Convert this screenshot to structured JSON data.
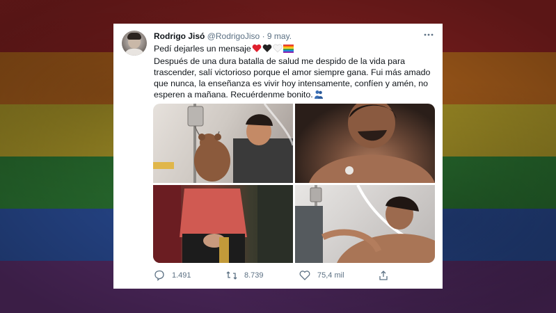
{
  "tweet": {
    "author_name": "Rodrigo Jisó",
    "handle": "@RodrigoJiso",
    "separator": "·",
    "date": "9 may.",
    "line1": "Pedí dejarles un mensaje",
    "body": "Después de una dura batalla de salud me despido de la vida para trascender, salí victorioso porque el amor siempre gana. Fui más amado que nunca, la enseñanza es vivir hoy intensamente, confíen y amén, no esperen a mañana. Recuérdenme bonito.",
    "replies": "1.491",
    "retweets": "8.739",
    "likes": "75,4 mil"
  },
  "icons": {
    "more": "more-icon",
    "reply": "reply-icon",
    "retweet": "retweet-icon",
    "like": "heart-icon",
    "share": "share-icon"
  },
  "colors": {
    "flag": [
      "#8a1f1f",
      "#b5651d",
      "#b8a52a",
      "#2f7a33",
      "#2a4f9a",
      "#5a2f6b"
    ],
    "text": "#0f1419",
    "muted": "#5b7083"
  }
}
